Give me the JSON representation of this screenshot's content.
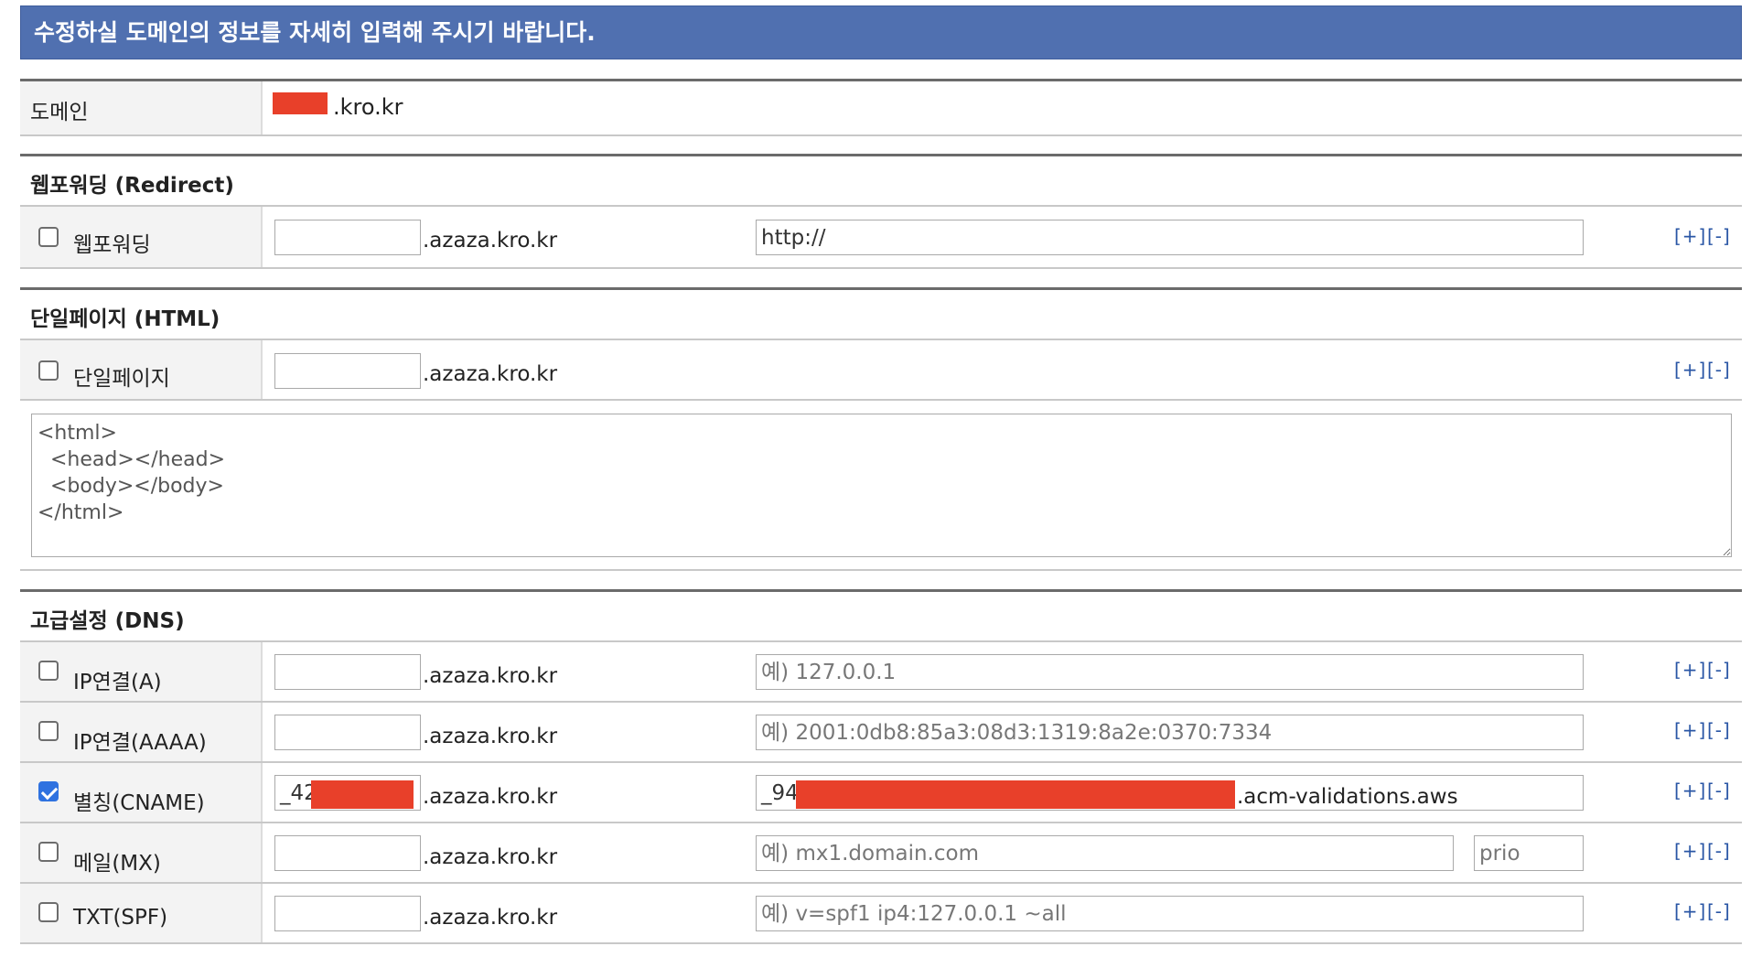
{
  "header": {
    "title": "수정하실 도메인의 정보를 자세히 입력해 주시기 바랍니다."
  },
  "domain": {
    "label": "도메인",
    "value": ".kro.kr"
  },
  "common": {
    "suffix": ".azaza.kro.kr",
    "add": "[+]",
    "remove": "[-]"
  },
  "redirect": {
    "section_title": "웹포워딩 (Redirect)",
    "label": "웹포워딩",
    "checked": false,
    "target_value": "http://"
  },
  "single_page": {
    "section_title": "단일페이지 (HTML)",
    "label": "단일페이지",
    "checked": false,
    "html_content": "<html>\n  <head></head>\n  <body></body>\n</html>"
  },
  "dns": {
    "section_title": "고급설정 (DNS)",
    "rows": [
      {
        "label": "IP연결(A)",
        "checked": false,
        "subdomain": "",
        "value_placeholder": "예) 127.0.0.1"
      },
      {
        "label": "IP연결(AAAA)",
        "checked": false,
        "subdomain": "",
        "value_placeholder": "예) 2001:0db8:85a3:08d3:1319:8a2e:0370:7334"
      },
      {
        "label": "별칭(CNAME)",
        "checked": true,
        "subdomain": "_42",
        "value": "_94",
        "value_suffix": ".acm-validations.aws"
      },
      {
        "label": "메일(MX)",
        "checked": false,
        "subdomain": "",
        "value_placeholder": "예) mx1.domain.com",
        "prio_placeholder": "prio"
      },
      {
        "label": "TXT(SPF)",
        "checked": false,
        "subdomain": "",
        "value_placeholder": "예) v=spf1 ip4:127.0.0.1 ~all"
      }
    ]
  },
  "colors": {
    "banner": "#5070b0",
    "link": "#2a56a5",
    "redaction": "#e8402a",
    "checkbox_checked": "#2f72e0"
  }
}
